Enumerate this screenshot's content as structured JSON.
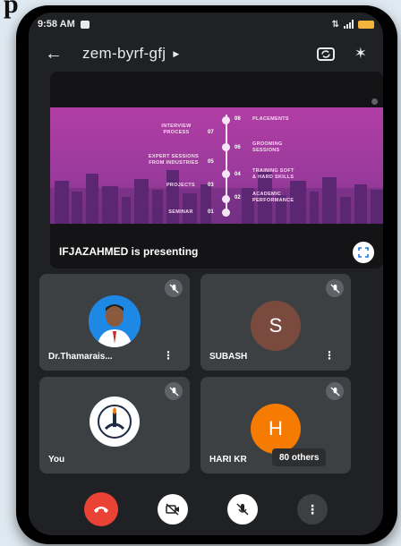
{
  "page": {
    "heading": "p"
  },
  "status_bar": {
    "time": "9:58 AM"
  },
  "header": {
    "meeting_code": "zem-byrf-gfj"
  },
  "presentation": {
    "presenter_text": "IFJAZAHMED is presenting",
    "slide": {
      "labels_left": [
        {
          "num": "07",
          "text": "INTERVIEW\nPROCESS"
        },
        {
          "num": "05",
          "text": "EXPERT SESSIONS\nFROM INDUSTRIES"
        },
        {
          "num": "03",
          "text": "PROJECTS"
        },
        {
          "num": "01",
          "text": "SEMINAR"
        }
      ],
      "labels_right": [
        {
          "num": "08",
          "text": "PLACEMENTS"
        },
        {
          "num": "06",
          "text": "GROOMING\nSESSIONS"
        },
        {
          "num": "04",
          "text": "TRAINING SOFT\n& HARD SKILLS"
        },
        {
          "num": "02",
          "text": "ACADEMIC\nPERFORMANCE"
        }
      ]
    }
  },
  "participants": [
    {
      "name": "Dr.Thamarais...",
      "avatar_type": "photo",
      "muted": true
    },
    {
      "name": "SUBASH",
      "initial": "S",
      "avatar_color": "#7a4a3f",
      "muted": true
    },
    {
      "name": "You",
      "avatar_type": "logo",
      "muted": true
    },
    {
      "name": "HARI KR",
      "initial": "H",
      "avatar_color": "#f57c00",
      "muted": true,
      "others_label": "80 others"
    }
  ],
  "controls": {
    "end_call_color": "#ea4335"
  }
}
